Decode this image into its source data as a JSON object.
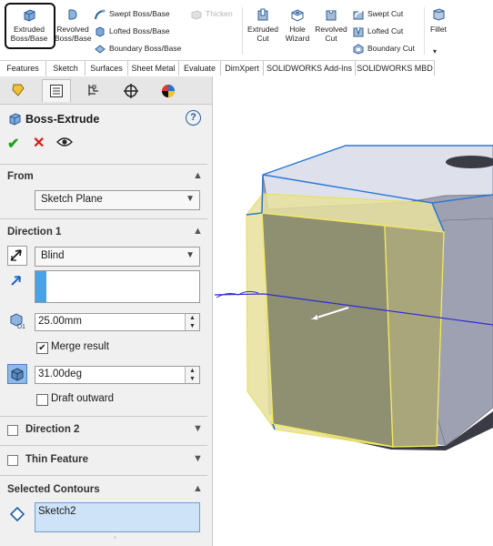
{
  "ribbon": {
    "extruded_boss": "Extruded Boss/Base",
    "revolved_boss": "Revolved Boss/Base",
    "swept_boss": "Swept Boss/Base",
    "lofted_boss": "Lofted Boss/Base",
    "boundary_boss": "Boundary Boss/Base",
    "thicken": "Thicken",
    "extruded_cut": "Extruded Cut",
    "hole_wizard": "Hole Wizard",
    "revolved_cut": "Revolved Cut",
    "swept_cut": "Swept Cut",
    "lofted_cut": "Lofted Cut",
    "boundary_cut": "Boundary Cut",
    "fillet": "Fillet"
  },
  "command_tabs": [
    "Features",
    "Sketch",
    "Surfaces",
    "Sheet Metal",
    "Evaluate",
    "DimXpert",
    "SOLIDWORKS Add-Ins",
    "SOLIDWORKS MBD"
  ],
  "feature": {
    "title": "Boss-Extrude"
  },
  "from": {
    "header": "From",
    "value": "Sketch Plane"
  },
  "direction1": {
    "header": "Direction 1",
    "end_condition": "Blind",
    "depth": "25.00mm",
    "merge_label": "Merge result",
    "merge_checked": true,
    "draft_angle": "31.00deg",
    "draft_label": "Draft outward",
    "draft_checked": false
  },
  "direction2": {
    "header": "Direction 2"
  },
  "thin_feature": {
    "header": "Thin Feature"
  },
  "selected_contours": {
    "header": "Selected Contours",
    "items": [
      "Sketch2"
    ]
  },
  "colors": {
    "preview_face": "#c9c98a",
    "body_top": "#d8dce8",
    "body_side": "#9ea1b2",
    "edge_highlight": "#2b78d6",
    "accept": "#21a121",
    "cancel": "#d51a1a"
  }
}
